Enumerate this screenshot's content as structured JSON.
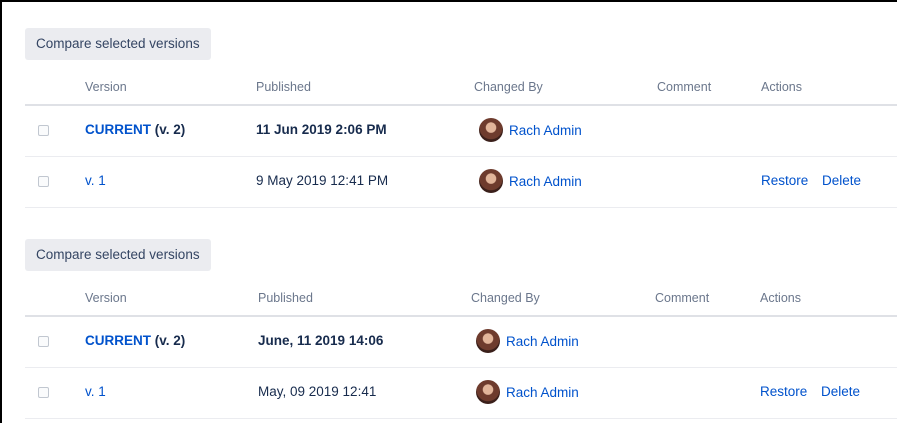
{
  "sections": [
    {
      "compare_label": "Compare selected versions",
      "columns": {
        "version": "Version",
        "published": "Published",
        "changed_by": "Changed By",
        "comment": "Comment",
        "actions": "Actions"
      },
      "rows": [
        {
          "current_label": "CURRENT",
          "version_suffix": "(v. 2)",
          "published": "11 Jun 2019 2:06 PM",
          "changed_by": "Rach Admin",
          "comment": "",
          "restore": "",
          "delete": ""
        },
        {
          "version_link": "v. 1",
          "published": "9 May 2019 12:41 PM",
          "changed_by": "Rach Admin",
          "comment": "",
          "restore": "Restore",
          "delete": "Delete"
        }
      ]
    },
    {
      "compare_label": "Compare selected versions",
      "columns": {
        "version": "Version",
        "published": "Published",
        "changed_by": "Changed By",
        "comment": "Comment",
        "actions": "Actions"
      },
      "rows": [
        {
          "current_label": "CURRENT",
          "version_suffix": "(v. 2)",
          "published": "June, 11 2019 14:06",
          "changed_by": "Rach Admin",
          "comment": "",
          "restore": "",
          "delete": ""
        },
        {
          "version_link": "v. 1",
          "published": "May, 09 2019 12:41",
          "changed_by": "Rach Admin",
          "comment": "",
          "restore": "Restore",
          "delete": "Delete"
        }
      ]
    }
  ],
  "colors": {
    "link": "#0052cc",
    "text": "#172b4d",
    "muted": "#6b778c",
    "button_bg": "#ebecf0"
  },
  "icons": {
    "avatar": "user-avatar"
  }
}
